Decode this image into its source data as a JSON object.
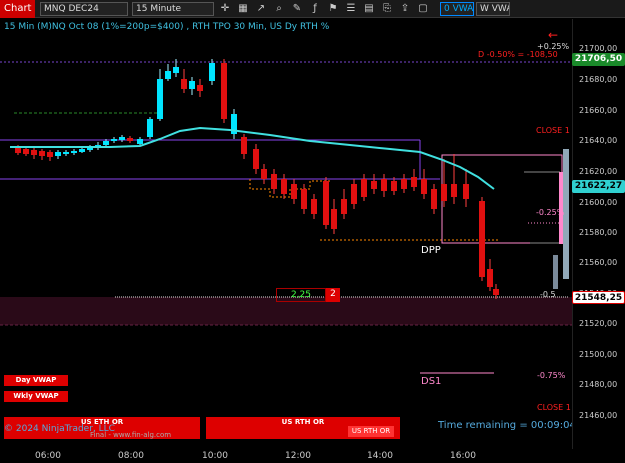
{
  "toolbar": {
    "chart_tab": "Chart",
    "instrument": "MNQ DEC24",
    "interval": "15 Minute",
    "vwap_btn": "0 VWAP",
    "wvwap_btn": "W VWAP",
    "icons": [
      "crosshair-icon",
      "data-box-icon",
      "drawing-tools-icon",
      "zoom-icon",
      "pencil-icon",
      "indicators-icon",
      "strategies-icon",
      "properties-icon",
      "templates-icon",
      "attach-icon",
      "share-icon",
      "window-icon"
    ]
  },
  "chart": {
    "title": "15 Min (M)NQ Oct 08 (1%=200p=$400) , RTH TPO 30 Min, US Dy RTH %",
    "copyright": "© 2024 NinjaTrader, LLC",
    "watermark": "Final - www.fin-alg.com",
    "time_remaining": "Time remaining = 00:09:04",
    "pct_up": "+0.25%",
    "drawdown": "D -0.50% = -108,50",
    "close1": "CLOSE 1",
    "close2": "CLOSE 1",
    "minus_025": "-0.25%",
    "minus_05": "-0.5",
    "minus_075": "-0.75%",
    "dpp": "DPP",
    "ds1": "DS1",
    "order_qty": "2,25",
    "order_count": "2",
    "day_vwap": "Day VWAP",
    "wkly_vwap": "Wkly VWAP",
    "us_eth_or": "US ETH OR",
    "us_rth_or": "US RTH OR",
    "us_rth_or2": "US RTH OR"
  },
  "price_axis": {
    "ticks": [
      "21700,00",
      "21680,00",
      "21660,00",
      "21640,00",
      "21620,00",
      "21600,00",
      "21580,00",
      "21560,00",
      "21540,00",
      "21520,00",
      "21500,00",
      "21480,00",
      "21460,00"
    ],
    "badge_top": "21706,50",
    "badge_mid": "21622,27",
    "badge_last": "21548,25"
  },
  "time_axis": {
    "ticks": [
      "06:00",
      "08:00",
      "10:00",
      "12:00",
      "14:00",
      "16:00"
    ]
  },
  "colors": {
    "up": "#00e5ff",
    "down": "#e01010",
    "vwap": "#40e0e0",
    "purple": "#8844ee",
    "pink": "#ff88cc"
  }
}
